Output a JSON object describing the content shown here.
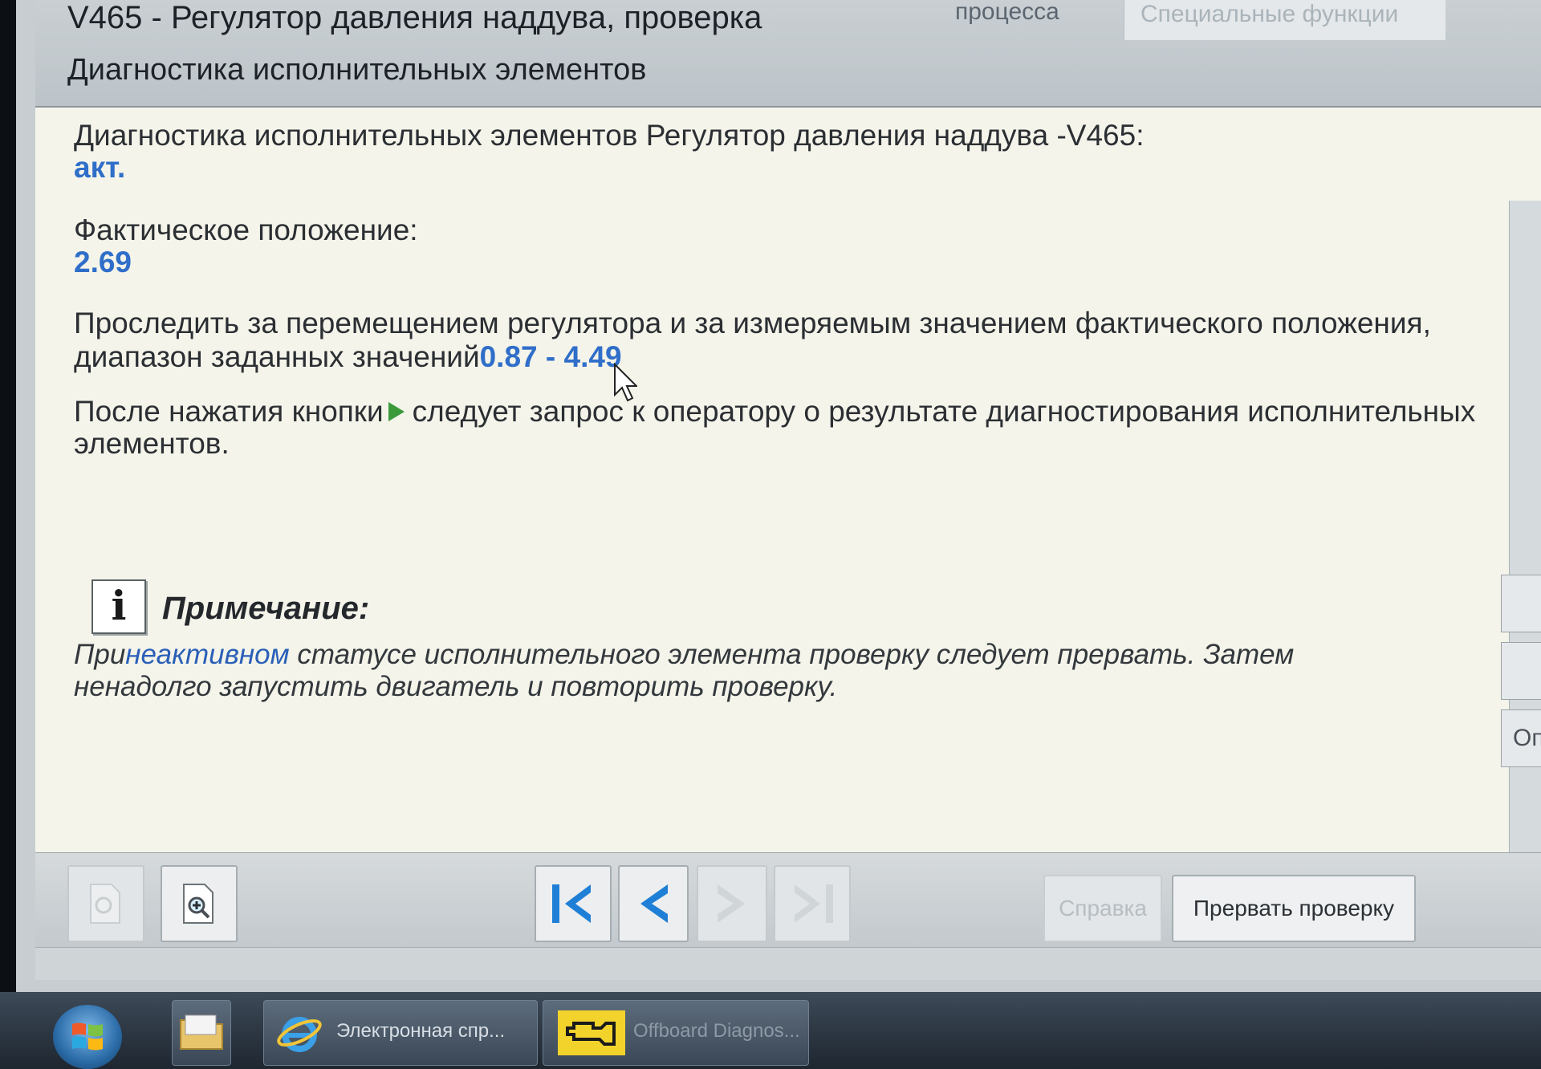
{
  "header": {
    "title": "V465 - Регулятор давления наддува, проверка",
    "subtitle": "Диагностика исполнительных элементов",
    "tab_process": "процесса",
    "tab_special": "Специальные функции"
  },
  "content": {
    "line1": "Диагностика исполнительных элементов Регулятор давления наддува -V465:",
    "status_value": "акт.",
    "actual_label": "Фактическое положение:",
    "actual_value": "2.69",
    "instruction_line1": "Проследить за перемещением регулятора и за измеряемым значением фактического положения,",
    "instruction_line2_prefix": "диапазон заданных значений",
    "range_value": "0.87 - 4.49",
    "after_press_prefix": "После нажатия кнопки",
    "after_press_suffix": "следует запрос к оператору о результате диагностирования исполнительных",
    "after_press_line2": "элементов.",
    "note_title": "Примечание:",
    "note_line1_prefix": "При",
    "note_line1_link": "неактивном",
    "note_line1_suffix": " статусе исполнительного элемента проверку следует прервать. Затем",
    "note_line2": "ненадолго запустить двигатель и повторить проверку."
  },
  "side": {
    "button_label": "Оп"
  },
  "toolbar": {
    "help_label": "Справка",
    "abort_label": "Прервать проверку"
  },
  "taskbar": {
    "ie_label": "Электронная спр...",
    "odis_label": "Offboard Diagnos..."
  },
  "colors": {
    "value_blue": "#2f6ec9",
    "link_blue": "#2a5fb8",
    "nav_blue": "#1f7fd6",
    "content_bg": "#f4f4ea"
  }
}
